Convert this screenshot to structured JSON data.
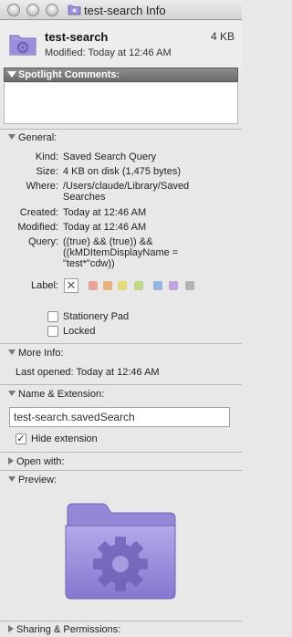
{
  "window": {
    "title": "test-search Info"
  },
  "header": {
    "name": "test-search",
    "size": "4 KB",
    "modified": "Modified: Today at 12:46 AM"
  },
  "spotlight": {
    "title": "Spotlight Comments:",
    "comments": ""
  },
  "general": {
    "title": "General:",
    "rows": [
      {
        "label": "Kind:",
        "value": "Saved Search Query"
      },
      {
        "label": "Size:",
        "value": "4 KB on disk (1,475 bytes)"
      },
      {
        "label": "Where:",
        "value": "/Users/claude/Library/Saved Searches"
      },
      {
        "label": "Created:",
        "value": "Today at 12:46 AM"
      },
      {
        "label": "Modified:",
        "value": "Today at 12:46 AM"
      },
      {
        "label": "Query:",
        "value": "((true) && (true)) && ((kMDItemDisplayName = \"test*\"cdw))"
      }
    ],
    "label_title": "Label:",
    "label_colors": [
      "#e8a39b",
      "#e9b27a",
      "#e4d77c",
      "#bfd984",
      "#94b7e2",
      "#c0a6dc",
      "#b3b3b3"
    ],
    "stationery_pad": "Stationery Pad",
    "locked": "Locked"
  },
  "more_info": {
    "title": "More Info:",
    "last_opened": "Last opened: Today at 12:46 AM"
  },
  "name_extension": {
    "title": "Name & Extension:",
    "file_name": "test-search.savedSearch",
    "hide_extension": "Hide extension"
  },
  "open_with": {
    "title": "Open with:"
  },
  "preview": {
    "title": "Preview:"
  },
  "sharing": {
    "title": "Sharing & Permissions:"
  }
}
